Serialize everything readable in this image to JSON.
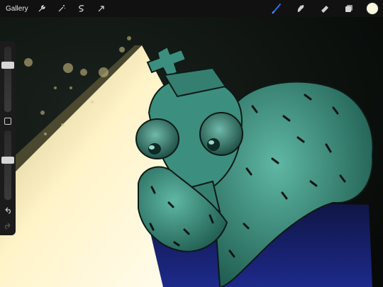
{
  "toolbar": {
    "gallery_label": "Gallery",
    "left_tools": [
      "wrench-icon",
      "magic-wand-icon",
      "selection-icon",
      "transform-arrow-icon"
    ],
    "right_tools": [
      "brush-icon",
      "smudge-icon",
      "eraser-icon",
      "layers-icon"
    ],
    "active_tool": "brush-icon",
    "color": "#fbf6de"
  },
  "sidebar": {
    "size_slider": 0.72,
    "opacity_slider": 0.57
  },
  "colors": {
    "canvas_bg": "#0b100d",
    "character_teal": "#3c8f7f",
    "cloak_blue": "#1a2166",
    "light_beam": "#fff7d6",
    "active_brush": "#2f6ff0"
  }
}
